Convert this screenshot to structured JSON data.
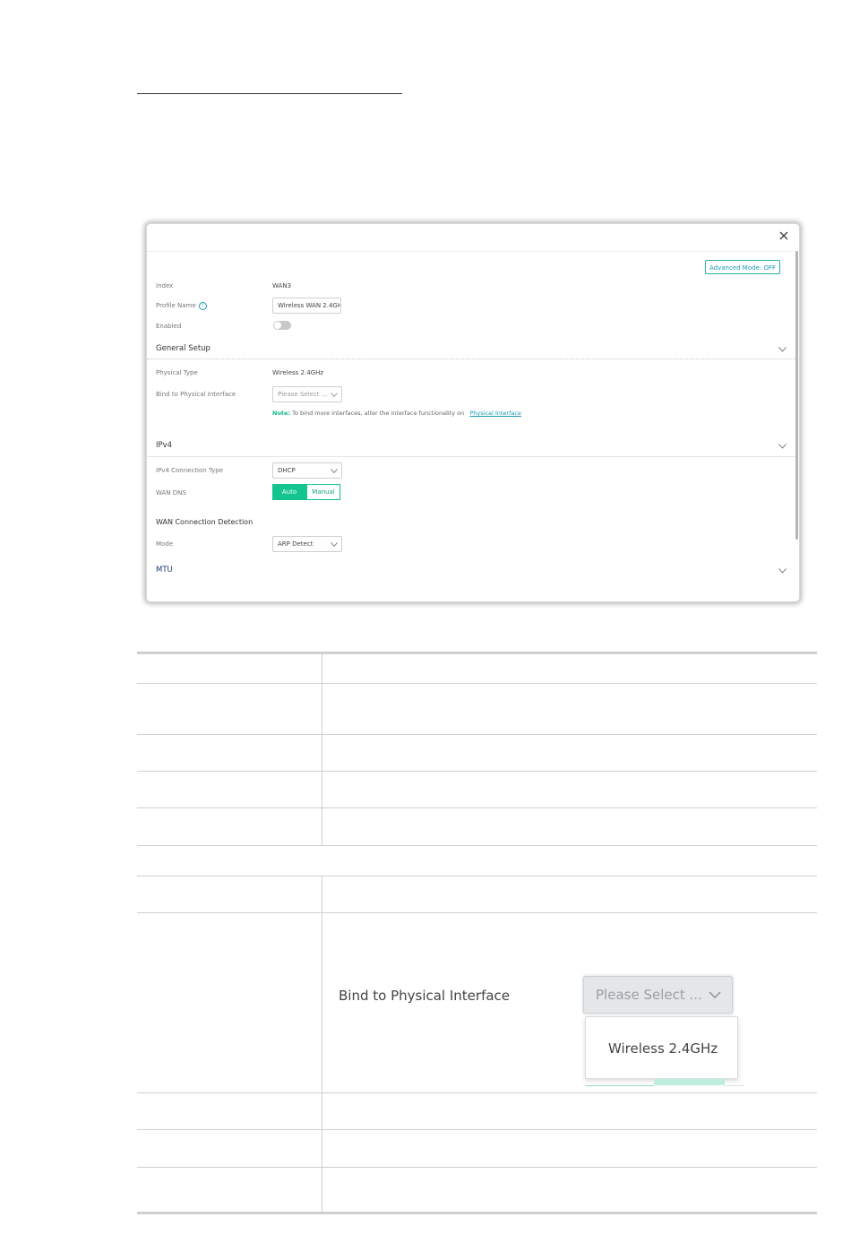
{
  "dialog": {
    "advanced_mode_label": "Advanced Mode: OFF",
    "fields": {
      "index_label": "Index",
      "index_value": "WAN3",
      "profile_name_label": "Profile Name",
      "profile_name_value": "Wireless WAN 2.4GHz",
      "enabled_label": "Enabled",
      "enabled_state": "off"
    },
    "general_setup": {
      "title": "General Setup",
      "physical_type_label": "Physical Type",
      "physical_type_value": "Wireless 2.4GHz",
      "bind_label": "Bind to Physical Interface",
      "bind_placeholder": "Please Select ...",
      "note_label": "Note:",
      "note_text": "To bind more interfaces, alter the interface functionality on",
      "note_link": "Physical Interface"
    },
    "ipv4": {
      "title": "IPv4",
      "connection_type_label": "IPv4 Connection Type",
      "connection_type_value": "DHCP",
      "wan_dns_label": "WAN DNS",
      "wan_dns_options": [
        "Auto",
        "Manual"
      ],
      "wan_dns_selected": "Auto",
      "detection_title": "WAN Connection Detection",
      "mode_label": "Mode",
      "mode_value": "ARP Detect"
    },
    "mtu": {
      "title": "MTU"
    },
    "colors": {
      "accent_green": "#14c491",
      "link_blue": "#1a9ab3",
      "text": "#444444"
    }
  },
  "zoom": {
    "label": "Bind to Physical Interface",
    "placeholder": "Please Select ...",
    "option": "Wireless 2.4GHz"
  }
}
